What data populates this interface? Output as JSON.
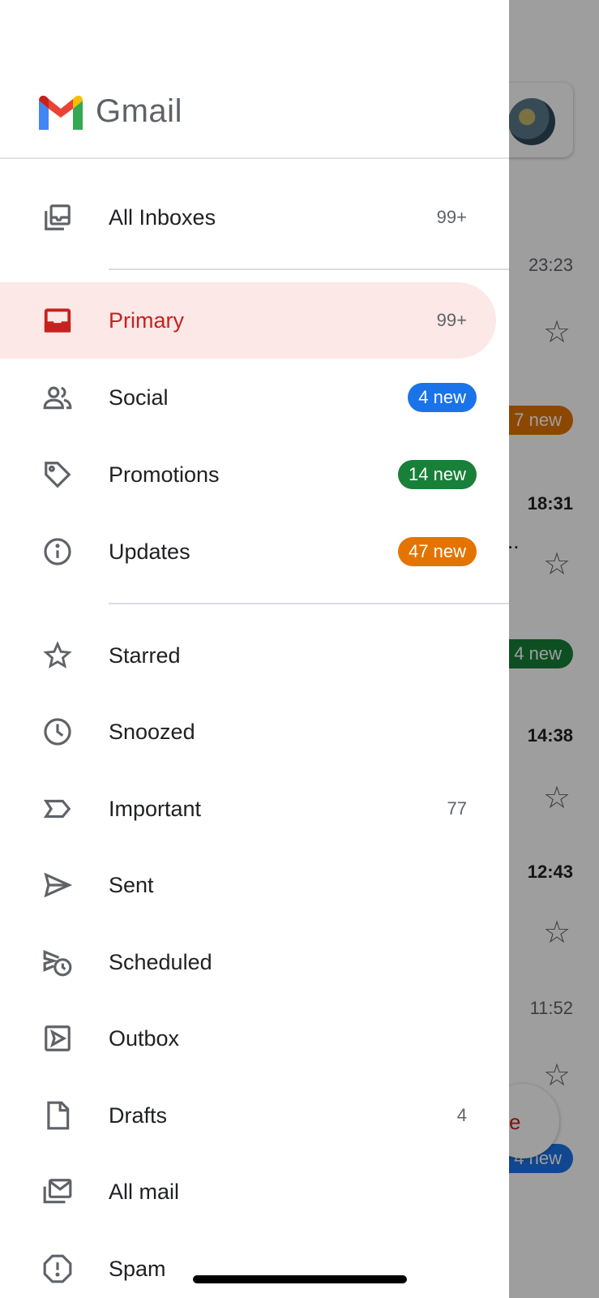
{
  "background": {
    "times": [
      "23:23",
      "18:31",
      "14:38",
      "12:43",
      "11:52"
    ],
    "pills": [
      {
        "text": "7 new",
        "color": "#e37400"
      },
      {
        "text": "4 new",
        "color": "#188038"
      },
      {
        "text": "4 new",
        "color": "#1a73e8"
      }
    ],
    "fab_text": "e"
  },
  "drawer": {
    "brand": "Gmail",
    "items": [
      {
        "label": "All Inboxes",
        "count": "99+",
        "icon": "all-inboxes-icon"
      },
      {
        "label": "Primary",
        "count": "99+",
        "icon": "inbox-icon",
        "active": true
      },
      {
        "label": "Social",
        "badge": "4 new",
        "badge_color": "#1a73e8",
        "icon": "people-icon"
      },
      {
        "label": "Promotions",
        "badge": "14 new",
        "badge_color": "#188038",
        "icon": "tag-icon"
      },
      {
        "label": "Updates",
        "badge": "47 new",
        "badge_color": "#e37400",
        "icon": "info-icon"
      },
      {
        "label": "Starred",
        "icon": "star-icon"
      },
      {
        "label": "Snoozed",
        "icon": "clock-icon"
      },
      {
        "label": "Important",
        "count": "77",
        "icon": "important-icon"
      },
      {
        "label": "Sent",
        "icon": "send-icon"
      },
      {
        "label": "Scheduled",
        "icon": "scheduled-send-icon"
      },
      {
        "label": "Outbox",
        "icon": "outbox-icon"
      },
      {
        "label": "Drafts",
        "count": "4",
        "icon": "draft-icon"
      },
      {
        "label": "All mail",
        "icon": "all-mail-icon"
      },
      {
        "label": "Spam",
        "icon": "spam-icon"
      }
    ]
  },
  "colors": {
    "active_bg": "#fce8e6",
    "active_text": "#c5221f"
  }
}
